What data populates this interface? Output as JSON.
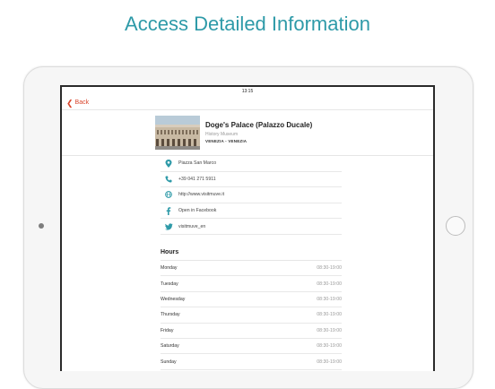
{
  "headline": "Access Detailed Information",
  "status_bar": {
    "time": "13:15"
  },
  "nav": {
    "back_label": "Back"
  },
  "place": {
    "title": "Doge's Palace (Palazzo Ducale)",
    "subtitle": "History Museum",
    "location": "VENEZIA - VENEZIA"
  },
  "contacts": [
    {
      "icon": "map-pin-icon",
      "text": "Piazza San Marco"
    },
    {
      "icon": "phone-icon",
      "text": "+39 041 271 5911"
    },
    {
      "icon": "globe-icon",
      "text": "http://www.visitmuve.it"
    },
    {
      "icon": "facebook-icon",
      "text": "Open in Facebook"
    },
    {
      "icon": "twitter-icon",
      "text": "visitmuve_en"
    }
  ],
  "hours": {
    "title": "Hours",
    "days": [
      {
        "day": "Monday",
        "time": "08:30-19:00"
      },
      {
        "day": "Tuesday",
        "time": "08:30-19:00"
      },
      {
        "day": "Wednesday",
        "time": "08:30-19:00"
      },
      {
        "day": "Thursday",
        "time": "08:30-19:00"
      },
      {
        "day": "Friday",
        "time": "08:30-19:00"
      },
      {
        "day": "Saturday",
        "time": "08:30-19:00"
      },
      {
        "day": "Sunday",
        "time": "08:30-19:00"
      }
    ]
  },
  "colors": {
    "accent": "#2e9aa8",
    "back": "#d9452c",
    "icon": "#2e9aa8"
  }
}
